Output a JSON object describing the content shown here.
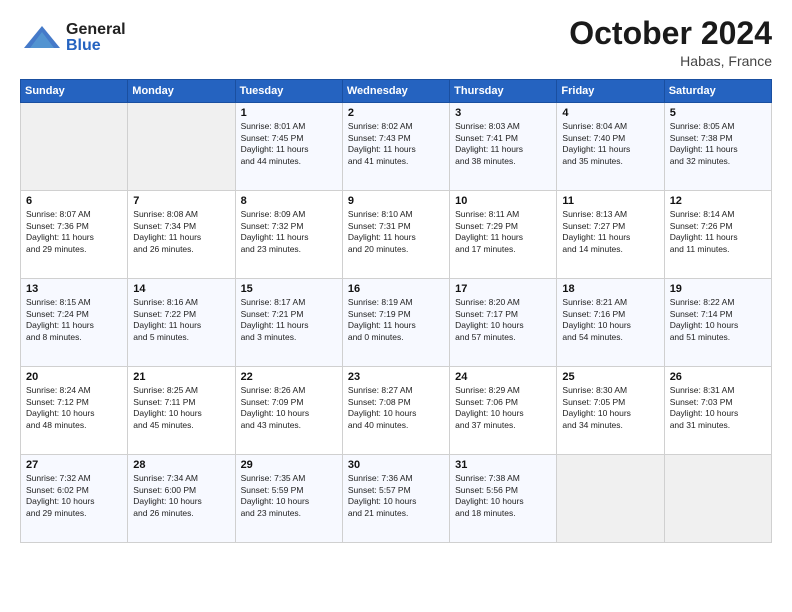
{
  "header": {
    "month_title": "October 2024",
    "location": "Habas, France",
    "logo_general": "General",
    "logo_blue": "Blue"
  },
  "weekdays": [
    "Sunday",
    "Monday",
    "Tuesday",
    "Wednesday",
    "Thursday",
    "Friday",
    "Saturday"
  ],
  "weeks": [
    [
      {
        "day": "",
        "info": ""
      },
      {
        "day": "",
        "info": ""
      },
      {
        "day": "1",
        "info": "Sunrise: 8:01 AM\nSunset: 7:45 PM\nDaylight: 11 hours\nand 44 minutes."
      },
      {
        "day": "2",
        "info": "Sunrise: 8:02 AM\nSunset: 7:43 PM\nDaylight: 11 hours\nand 41 minutes."
      },
      {
        "day": "3",
        "info": "Sunrise: 8:03 AM\nSunset: 7:41 PM\nDaylight: 11 hours\nand 38 minutes."
      },
      {
        "day": "4",
        "info": "Sunrise: 8:04 AM\nSunset: 7:40 PM\nDaylight: 11 hours\nand 35 minutes."
      },
      {
        "day": "5",
        "info": "Sunrise: 8:05 AM\nSunset: 7:38 PM\nDaylight: 11 hours\nand 32 minutes."
      }
    ],
    [
      {
        "day": "6",
        "info": "Sunrise: 8:07 AM\nSunset: 7:36 PM\nDaylight: 11 hours\nand 29 minutes."
      },
      {
        "day": "7",
        "info": "Sunrise: 8:08 AM\nSunset: 7:34 PM\nDaylight: 11 hours\nand 26 minutes."
      },
      {
        "day": "8",
        "info": "Sunrise: 8:09 AM\nSunset: 7:32 PM\nDaylight: 11 hours\nand 23 minutes."
      },
      {
        "day": "9",
        "info": "Sunrise: 8:10 AM\nSunset: 7:31 PM\nDaylight: 11 hours\nand 20 minutes."
      },
      {
        "day": "10",
        "info": "Sunrise: 8:11 AM\nSunset: 7:29 PM\nDaylight: 11 hours\nand 17 minutes."
      },
      {
        "day": "11",
        "info": "Sunrise: 8:13 AM\nSunset: 7:27 PM\nDaylight: 11 hours\nand 14 minutes."
      },
      {
        "day": "12",
        "info": "Sunrise: 8:14 AM\nSunset: 7:26 PM\nDaylight: 11 hours\nand 11 minutes."
      }
    ],
    [
      {
        "day": "13",
        "info": "Sunrise: 8:15 AM\nSunset: 7:24 PM\nDaylight: 11 hours\nand 8 minutes."
      },
      {
        "day": "14",
        "info": "Sunrise: 8:16 AM\nSunset: 7:22 PM\nDaylight: 11 hours\nand 5 minutes."
      },
      {
        "day": "15",
        "info": "Sunrise: 8:17 AM\nSunset: 7:21 PM\nDaylight: 11 hours\nand 3 minutes."
      },
      {
        "day": "16",
        "info": "Sunrise: 8:19 AM\nSunset: 7:19 PM\nDaylight: 11 hours\nand 0 minutes."
      },
      {
        "day": "17",
        "info": "Sunrise: 8:20 AM\nSunset: 7:17 PM\nDaylight: 10 hours\nand 57 minutes."
      },
      {
        "day": "18",
        "info": "Sunrise: 8:21 AM\nSunset: 7:16 PM\nDaylight: 10 hours\nand 54 minutes."
      },
      {
        "day": "19",
        "info": "Sunrise: 8:22 AM\nSunset: 7:14 PM\nDaylight: 10 hours\nand 51 minutes."
      }
    ],
    [
      {
        "day": "20",
        "info": "Sunrise: 8:24 AM\nSunset: 7:12 PM\nDaylight: 10 hours\nand 48 minutes."
      },
      {
        "day": "21",
        "info": "Sunrise: 8:25 AM\nSunset: 7:11 PM\nDaylight: 10 hours\nand 45 minutes."
      },
      {
        "day": "22",
        "info": "Sunrise: 8:26 AM\nSunset: 7:09 PM\nDaylight: 10 hours\nand 43 minutes."
      },
      {
        "day": "23",
        "info": "Sunrise: 8:27 AM\nSunset: 7:08 PM\nDaylight: 10 hours\nand 40 minutes."
      },
      {
        "day": "24",
        "info": "Sunrise: 8:29 AM\nSunset: 7:06 PM\nDaylight: 10 hours\nand 37 minutes."
      },
      {
        "day": "25",
        "info": "Sunrise: 8:30 AM\nSunset: 7:05 PM\nDaylight: 10 hours\nand 34 minutes."
      },
      {
        "day": "26",
        "info": "Sunrise: 8:31 AM\nSunset: 7:03 PM\nDaylight: 10 hours\nand 31 minutes."
      }
    ],
    [
      {
        "day": "27",
        "info": "Sunrise: 7:32 AM\nSunset: 6:02 PM\nDaylight: 10 hours\nand 29 minutes."
      },
      {
        "day": "28",
        "info": "Sunrise: 7:34 AM\nSunset: 6:00 PM\nDaylight: 10 hours\nand 26 minutes."
      },
      {
        "day": "29",
        "info": "Sunrise: 7:35 AM\nSunset: 5:59 PM\nDaylight: 10 hours\nand 23 minutes."
      },
      {
        "day": "30",
        "info": "Sunrise: 7:36 AM\nSunset: 5:57 PM\nDaylight: 10 hours\nand 21 minutes."
      },
      {
        "day": "31",
        "info": "Sunrise: 7:38 AM\nSunset: 5:56 PM\nDaylight: 10 hours\nand 18 minutes."
      },
      {
        "day": "",
        "info": ""
      },
      {
        "day": "",
        "info": ""
      }
    ]
  ]
}
